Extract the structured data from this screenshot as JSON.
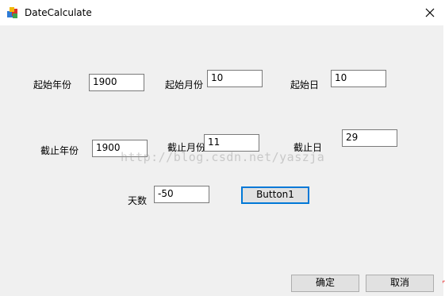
{
  "window": {
    "title": "DateCalculate"
  },
  "form": {
    "start_year_label": "起始年份",
    "start_year_value": "1900",
    "start_month_label": "起始月份",
    "start_month_value": "10",
    "start_day_label": "起始日",
    "start_day_value": "10",
    "end_year_label": "截止年份",
    "end_year_value": "1900",
    "end_month_label": "截止月份",
    "end_month_value": "11",
    "end_day_label": "截止日",
    "end_day_value": "29",
    "days_label": "天数",
    "days_value": "-50",
    "calc_button_label": "Button1"
  },
  "footer": {
    "ok_label": "确定",
    "cancel_label": "取消"
  },
  "watermark": {
    "text": "http://blog.csdn.net/yaszja"
  },
  "icons": {
    "app": "app-icon",
    "close": "close-icon"
  },
  "colors": {
    "default_button_border": "#0078d7",
    "dialog_background": "#f0f0f0"
  }
}
